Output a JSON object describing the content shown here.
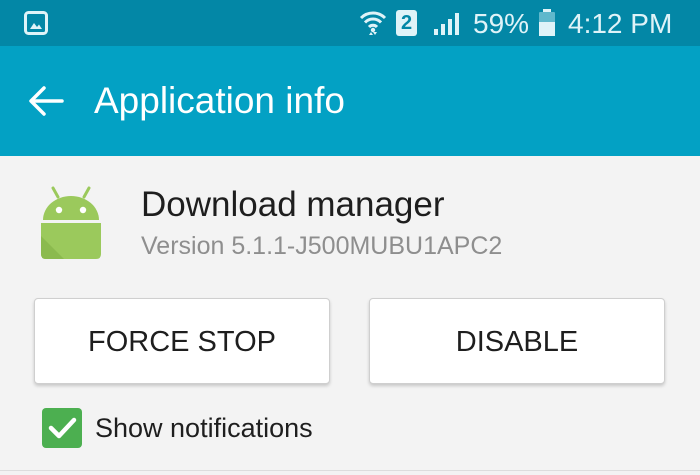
{
  "status_bar": {
    "icons": [
      "gallery-notification-icon",
      "wifi-icon",
      "sim-2-icon",
      "signal-icon",
      "battery-icon"
    ],
    "sim_label": "2",
    "battery_percent": "59%",
    "battery_level": 0.59,
    "time": "4:12 PM"
  },
  "app_bar": {
    "back_icon": "arrow-back-icon",
    "title": "Application info"
  },
  "app": {
    "icon": "android-icon",
    "name": "Download manager",
    "version": "Version 5.1.1-J500MUBU1APC2"
  },
  "actions": {
    "force_stop_label": "FORCE STOP",
    "disable_label": "DISABLE"
  },
  "notifications": {
    "label": "Show notifications",
    "checked": true
  },
  "colors": {
    "status_bar": "#0387a6",
    "app_bar": "#03a1c4",
    "background": "#f3f3f3",
    "android_green": "#9bc95c",
    "checkbox_green": "#4caf50"
  }
}
